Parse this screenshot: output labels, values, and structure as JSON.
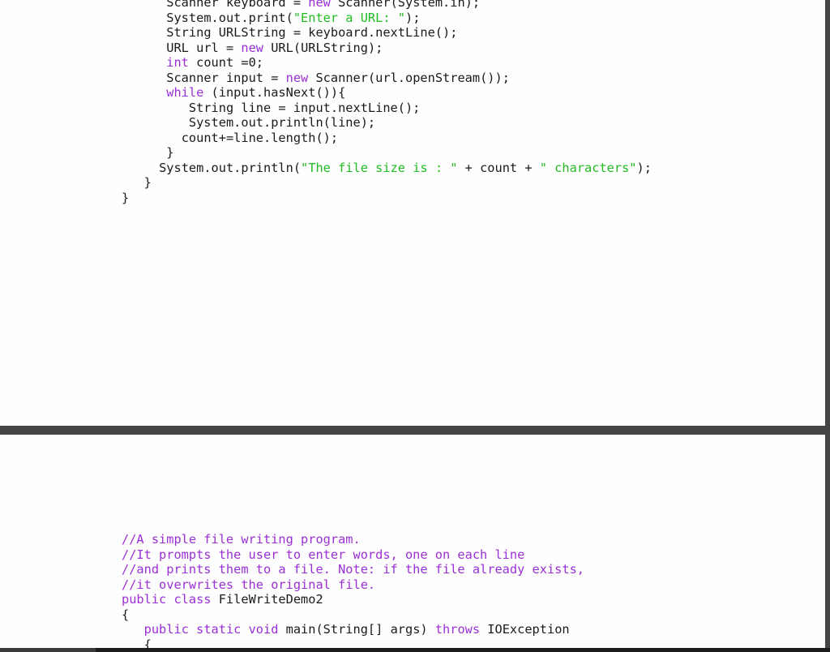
{
  "colors": {
    "keyword": "#9b2fd6",
    "string": "#22bb22",
    "comment": "#9b2fd6",
    "text": "#1a1a1a",
    "separator": "#454545",
    "background": "#ffffff"
  },
  "top_page": {
    "lines": [
      {
        "indent": "      ",
        "tokens": [
          {
            "t": "Scanner keyboard = ",
            "c": "txt"
          },
          {
            "t": "new",
            "c": "kw"
          },
          {
            "t": " Scanner(System.in);",
            "c": "txt"
          }
        ]
      },
      {
        "indent": "      ",
        "tokens": [
          {
            "t": "System.out.print(",
            "c": "txt"
          },
          {
            "t": "\"Enter a URL: \"",
            "c": "str"
          },
          {
            "t": ");",
            "c": "txt"
          }
        ]
      },
      {
        "indent": "      ",
        "tokens": [
          {
            "t": "String URLString = keyboard.nextLine();",
            "c": "txt"
          }
        ]
      },
      {
        "indent": "      ",
        "tokens": [
          {
            "t": "URL url = ",
            "c": "txt"
          },
          {
            "t": "new",
            "c": "kw"
          },
          {
            "t": " URL(URLString);",
            "c": "txt"
          }
        ]
      },
      {
        "indent": "      ",
        "tokens": [
          {
            "t": "int",
            "c": "kw"
          },
          {
            "t": " count =0;",
            "c": "txt"
          }
        ]
      },
      {
        "indent": "      ",
        "tokens": [
          {
            "t": "Scanner input = ",
            "c": "txt"
          },
          {
            "t": "new",
            "c": "kw"
          },
          {
            "t": " Scanner(url.openStream());",
            "c": "txt"
          }
        ]
      },
      {
        "indent": "      ",
        "tokens": [
          {
            "t": "while",
            "c": "kw"
          },
          {
            "t": " (input.hasNext()){",
            "c": "txt"
          }
        ]
      },
      {
        "indent": "         ",
        "tokens": [
          {
            "t": "String line = input.nextLine();",
            "c": "txt"
          }
        ]
      },
      {
        "indent": "         ",
        "tokens": [
          {
            "t": "System.out.println(line);",
            "c": "txt"
          }
        ]
      },
      {
        "indent": "        ",
        "tokens": [
          {
            "t": "count+=line.length();",
            "c": "txt"
          }
        ]
      },
      {
        "indent": "      ",
        "tokens": [
          {
            "t": "}",
            "c": "txt"
          }
        ]
      },
      {
        "indent": "     ",
        "tokens": [
          {
            "t": "System.out.println(",
            "c": "txt"
          },
          {
            "t": "\"The file size is : \"",
            "c": "str"
          },
          {
            "t": " + count + ",
            "c": "txt"
          },
          {
            "t": "\" characters\"",
            "c": "str"
          },
          {
            "t": ");",
            "c": "txt"
          }
        ]
      },
      {
        "indent": "   ",
        "tokens": [
          {
            "t": "}",
            "c": "txt"
          }
        ]
      },
      {
        "indent": "",
        "tokens": [
          {
            "t": "}",
            "c": "txt"
          }
        ]
      }
    ]
  },
  "bottom_page": {
    "lines": [
      {
        "indent": "",
        "tokens": [
          {
            "t": "//A simple file writing program.",
            "c": "cm"
          }
        ]
      },
      {
        "indent": "",
        "tokens": [
          {
            "t": "//It prompts the user to enter words, one on each line",
            "c": "cm"
          }
        ]
      },
      {
        "indent": "",
        "tokens": [
          {
            "t": "//and prints them to a file. Note: if the file already exists,",
            "c": "cm"
          }
        ]
      },
      {
        "indent": "",
        "tokens": [
          {
            "t": "//it overwrites the original file.",
            "c": "cm"
          }
        ]
      },
      {
        "indent": "",
        "tokens": [
          {
            "t": "public class",
            "c": "kw"
          },
          {
            "t": " FileWriteDemo2",
            "c": "txt"
          }
        ]
      },
      {
        "indent": "",
        "tokens": [
          {
            "t": "{",
            "c": "txt"
          }
        ]
      },
      {
        "indent": "   ",
        "tokens": [
          {
            "t": "public static void",
            "c": "kw"
          },
          {
            "t": " main(String[] args) ",
            "c": "txt"
          },
          {
            "t": "throws",
            "c": "kw"
          },
          {
            "t": " IOException",
            "c": "txt"
          }
        ]
      },
      {
        "indent": "   ",
        "tokens": [
          {
            "t": "{",
            "c": "txt"
          }
        ]
      }
    ]
  }
}
